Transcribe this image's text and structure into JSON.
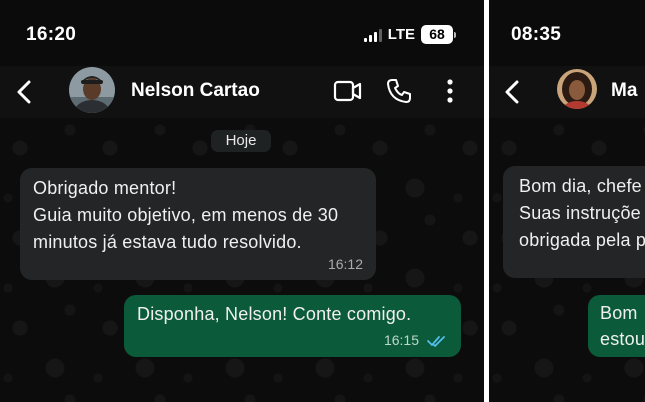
{
  "left_screen": {
    "status": {
      "time": "16:20",
      "network": "LTE",
      "battery": "68"
    },
    "contact": {
      "name": "Nelson Cartao"
    },
    "date_chip": "Hoje",
    "incoming": {
      "lines": [
        "Obrigado mentor!",
        "Guia muito objetivo, em menos de 30",
        "minutos já estava tudo resolvido."
      ],
      "time": "16:12"
    },
    "outgoing": {
      "text": "Disponha, Nelson! Conte comigo.",
      "time": "16:15",
      "status": "read"
    }
  },
  "right_screen": {
    "status": {
      "time": "08:35"
    },
    "contact": {
      "name": "Ma"
    },
    "incoming": {
      "lines": [
        "Bom dia, chefe",
        "Suas instruçõe",
        "obrigada pela p"
      ]
    },
    "outgoing": {
      "lines": [
        "Bom",
        "estou"
      ]
    }
  },
  "colors": {
    "chat_bg": "#0c0c0c",
    "header_bg": "#111111",
    "incoming_bubble": "#232526",
    "outgoing_bubble": "#0b5b3a",
    "read_ticks": "#53bdeb"
  },
  "icons": [
    "back-arrow-icon",
    "video-call-icon",
    "phone-call-icon",
    "more-options-icon",
    "double-check-icon"
  ]
}
